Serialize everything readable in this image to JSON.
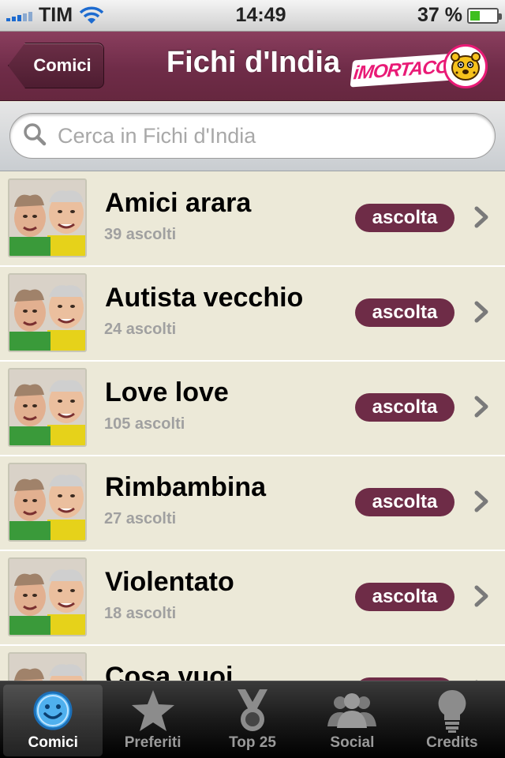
{
  "status_bar": {
    "carrier": "TIM",
    "time": "14:49",
    "battery_percent": "37 %",
    "battery_level": 0.37
  },
  "nav": {
    "back_label": "Comici",
    "title": "Fichi d'India",
    "logo_text": "iMORTACCI"
  },
  "search": {
    "placeholder": "Cerca in Fichi d'India",
    "value": ""
  },
  "list": {
    "items": [
      {
        "title": "Amici arara",
        "subtitle": "39 ascolti",
        "button": "ascolta"
      },
      {
        "title": "Autista vecchio",
        "subtitle": "24 ascolti",
        "button": "ascolta"
      },
      {
        "title": "Love love",
        "subtitle": "105 ascolti",
        "button": "ascolta"
      },
      {
        "title": "Rimbambina",
        "subtitle": "27 ascolti",
        "button": "ascolta"
      },
      {
        "title": "Violentato",
        "subtitle": "18 ascolti",
        "button": "ascolta"
      },
      {
        "title": "Cosa vuoi",
        "subtitle": "",
        "button": "ascolta"
      }
    ]
  },
  "tabs": [
    {
      "label": "Comici",
      "icon": "smiley-icon",
      "active": true
    },
    {
      "label": "Preferiti",
      "icon": "star-icon",
      "active": false
    },
    {
      "label": "Top 25",
      "icon": "medal-icon",
      "active": false
    },
    {
      "label": "Social",
      "icon": "people-icon",
      "active": false
    },
    {
      "label": "Credits",
      "icon": "lightbulb-icon",
      "active": false
    }
  ],
  "colors": {
    "accent": "#6e2c47",
    "list_background": "#ece9d8",
    "logo_pink": "#e91a76"
  }
}
